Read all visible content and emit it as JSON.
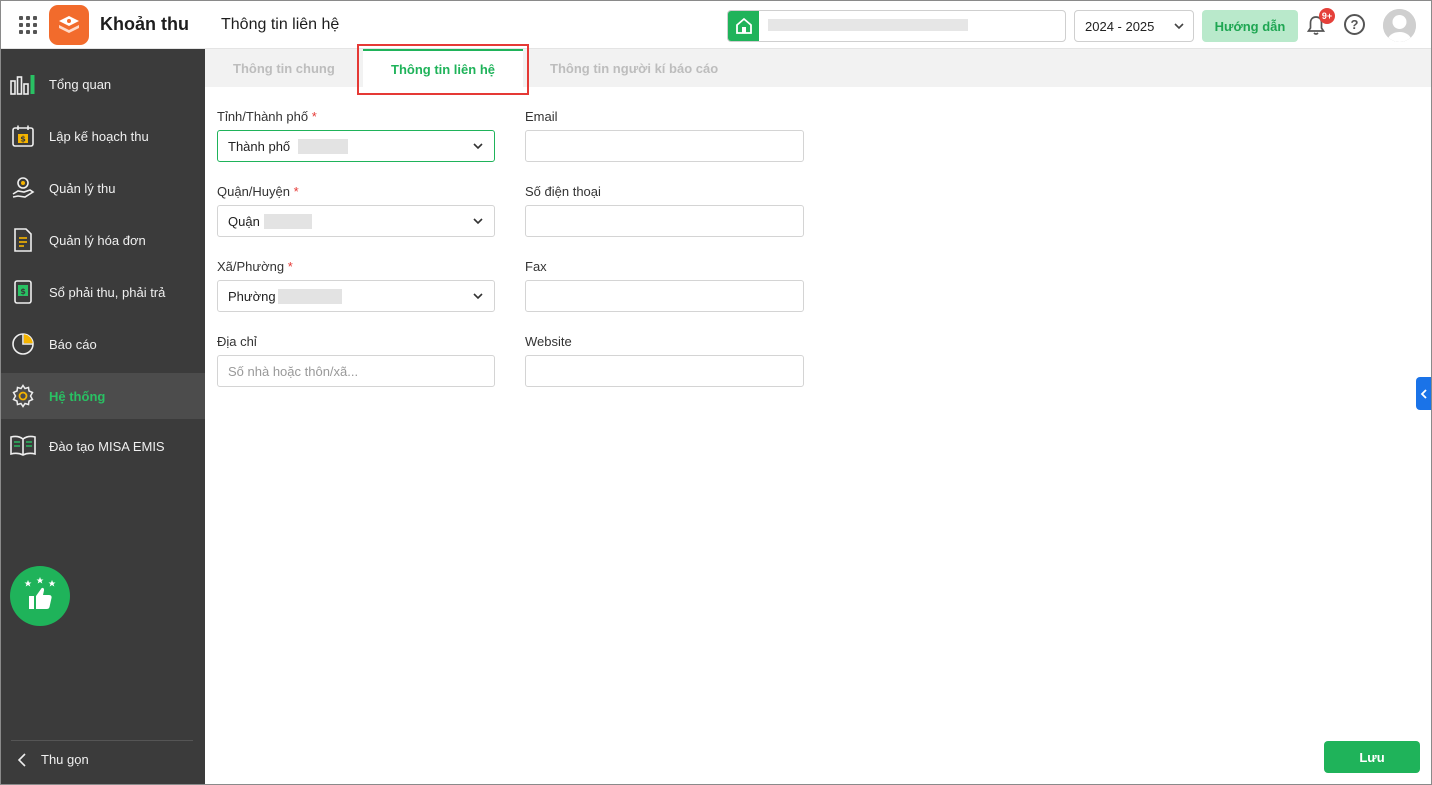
{
  "header": {
    "app_name": "Khoản thu",
    "page_title": "Thông tin liên hệ",
    "year": "2024 - 2025",
    "guide_label": "Hướng dẫn",
    "notification_badge": "9+",
    "help_symbol": "?"
  },
  "sidebar": {
    "items": [
      {
        "label": "Tổng quan",
        "icon": "bar-chart-icon"
      },
      {
        "label": "Lập kế hoạch thu",
        "icon": "calendar-money-icon"
      },
      {
        "label": "Quản lý thu",
        "icon": "coin-hand-icon"
      },
      {
        "label": "Quản lý hóa đơn",
        "icon": "invoice-icon"
      },
      {
        "label": "Sổ phải thu, phải trả",
        "icon": "ledger-icon"
      },
      {
        "label": "Báo cáo",
        "icon": "pie-chart-icon"
      },
      {
        "label": "Hệ thống",
        "icon": "gear-icon"
      },
      {
        "label": "Đào tạo MISA EMIS",
        "icon": "book-icon"
      }
    ],
    "active_item": "Hệ thống",
    "collapse_label": "Thu gọn"
  },
  "tabs": [
    {
      "label": "Thông tin chung"
    },
    {
      "label": "Thông tin liên hệ"
    },
    {
      "label": "Thông tin người kí báo cáo"
    }
  ],
  "form": {
    "province": {
      "label": "Tỉnh/Thành phố",
      "required": "*",
      "value": "Thành phố"
    },
    "district": {
      "label": "Quận/Huyện",
      "required": "*",
      "value": "Quận"
    },
    "ward": {
      "label": "Xã/Phường",
      "required": "*",
      "value": "Phường"
    },
    "address": {
      "label": "Địa chỉ",
      "placeholder": "Số nhà hoặc thôn/xã..."
    },
    "email": {
      "label": "Email",
      "value": ""
    },
    "phone": {
      "label": "Số điện thoại",
      "value": ""
    },
    "fax": {
      "label": "Fax",
      "value": ""
    },
    "website": {
      "label": "Website",
      "value": ""
    }
  },
  "actions": {
    "save_label": "Lưu"
  },
  "colors": {
    "primary": "#1fb35a",
    "sidebar_bg": "#3b3b3b",
    "highlight_border": "#e53935",
    "logo": "#f26b2c"
  }
}
